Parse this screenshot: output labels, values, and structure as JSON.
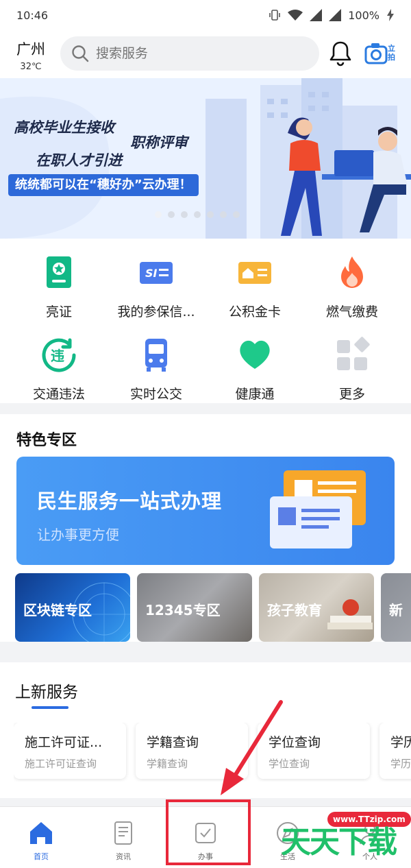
{
  "status_bar": {
    "time": "10:46",
    "battery": "100%"
  },
  "header": {
    "city": "广州",
    "temperature": "32℃",
    "search_placeholder": "搜索服务",
    "camera_label": "立拍"
  },
  "banner": {
    "line1": "高校毕业生接收",
    "line2": "职称评审",
    "line3": "在职人才引进",
    "strip": "统统都可以在“穗好办”云办理！",
    "slide_count": 7,
    "active_slide": 0
  },
  "quick_services": [
    {
      "label": "亮证",
      "icon": "id-card-icon",
      "color": "#12b886"
    },
    {
      "label": "我的参保信...",
      "icon": "social-insurance-icon",
      "color": "#4b7bec"
    },
    {
      "label": "公积金卡",
      "icon": "housing-fund-card-icon",
      "color": "#f5a623"
    },
    {
      "label": "燃气缴费",
      "icon": "flame-icon",
      "color": "#ff6b3d"
    },
    {
      "label": "交通违法",
      "icon": "traffic-violation-icon",
      "color": "#12b886"
    },
    {
      "label": "实时公交",
      "icon": "bus-icon",
      "color": "#4b7bec"
    },
    {
      "label": "健康通",
      "icon": "heart-icon",
      "color": "#1ec98a"
    },
    {
      "label": "更多",
      "icon": "more-grid-icon",
      "color": "#c9ccd3"
    }
  ],
  "feature": {
    "title": "特色专区",
    "card_title": "民生服务一站式办理",
    "card_subtitle": "让办事更方便",
    "tiles": [
      {
        "label": "区块链专区"
      },
      {
        "label": "12345专区"
      },
      {
        "label": "孩子教育"
      },
      {
        "label": "新"
      }
    ]
  },
  "new_services": {
    "title": "上新服务",
    "items": [
      {
        "name": "施工许可证...",
        "sub": "施工许可证查询"
      },
      {
        "name": "学籍查询",
        "sub": "学籍查询"
      },
      {
        "name": "学位查询",
        "sub": "学位查询"
      },
      {
        "name": "学历",
        "sub": "学历"
      }
    ]
  },
  "tabs": [
    {
      "label": "首页",
      "icon": "home-icon",
      "active": true
    },
    {
      "label": "资讯",
      "icon": "news-icon",
      "active": false
    },
    {
      "label": "办事",
      "icon": "task-check-icon",
      "active": false
    },
    {
      "label": "生活",
      "icon": "compass-icon",
      "active": false
    },
    {
      "label": "个人",
      "icon": "person-icon",
      "active": false
    }
  ],
  "watermark": {
    "badge": "www.TTzip.com",
    "text": "天天下载"
  },
  "colors": {
    "primary": "#2b6be0",
    "annotation": "#e8283a",
    "watermark_green": "#20c06a"
  }
}
